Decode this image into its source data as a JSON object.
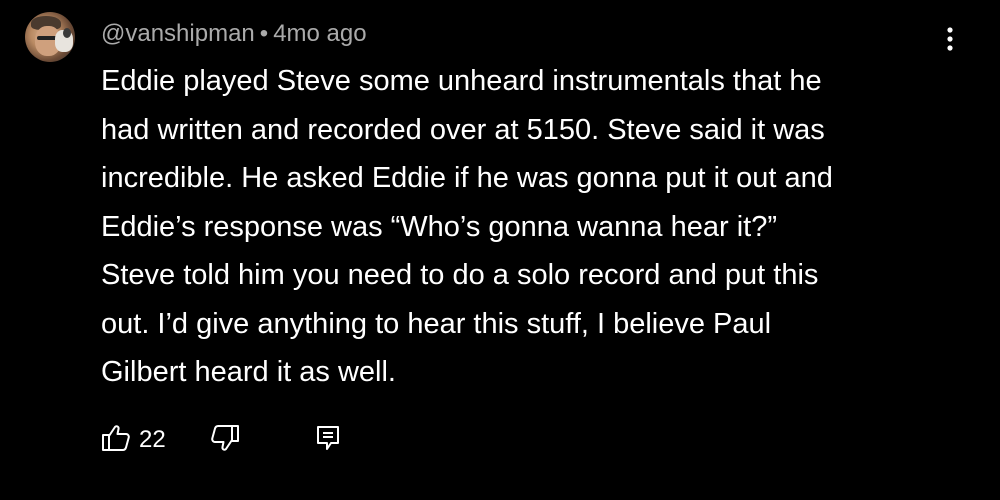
{
  "comment": {
    "author": "@vanshipman",
    "separator": "•",
    "time_ago": "4mo ago",
    "text": "Eddie played Steve some unheard instrumentals that he\nhad written and recorded over at 5150. Steve said it was\nincredible. He asked Eddie if he was gonna put it out and\nEddie’s response was “Who’s gonna wanna hear it?”\nSteve told him you need to do a solo record and put this\nout. I’d give anything to hear this stuff, I believe Paul\nGilbert heard it as well.",
    "like_count": "22"
  },
  "icons": {
    "menu": "more-vert-icon",
    "like": "thumbs-up-icon",
    "dislike": "thumbs-down-icon",
    "reply": "reply-comment-icon"
  },
  "colors": {
    "background": "#000000",
    "text": "#ffffff",
    "meta": "#aaaaaa"
  }
}
